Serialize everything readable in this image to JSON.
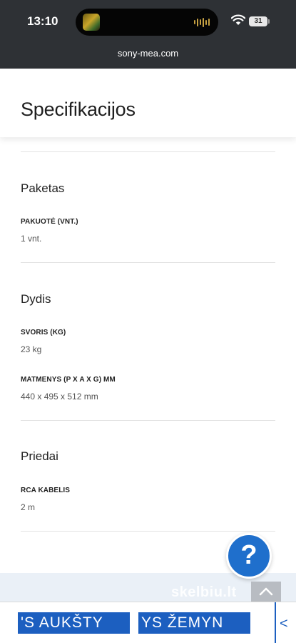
{
  "status_bar": {
    "time": "13:10",
    "battery": "31"
  },
  "browser": {
    "url": "sony-mea.com"
  },
  "page": {
    "title": "Specifikacijos"
  },
  "sections": [
    {
      "title": "Paketas",
      "specs": [
        {
          "label": "PAKUOTĖ (VNT.)",
          "value": "1 vnt."
        }
      ]
    },
    {
      "title": "Dydis",
      "specs": [
        {
          "label": "SVORIS (KG)",
          "value": "23 kg"
        },
        {
          "label": "MATMENYS (P X A X G) MM",
          "value": "440 x 495 x 512 mm"
        }
      ]
    },
    {
      "title": "Priedai",
      "specs": [
        {
          "label": "RCA KABELIS",
          "value": "2 m"
        }
      ]
    }
  ],
  "help": {
    "label": "?"
  },
  "watermark": {
    "text": "skelbiu.lt"
  },
  "toolbar": {
    "scroll_up_label": "'S AUKŠTY",
    "scroll_down_label": "YS ŽEMYN",
    "arrow_label": "<"
  },
  "colors": {
    "accent": "#1c5fc0",
    "help_button": "#1f6fcc",
    "status_bar": "#2e3135"
  },
  "icons": [
    "wifi-icon",
    "battery-icon",
    "now-playing-icon",
    "scroll-top-icon",
    "help-icon"
  ]
}
